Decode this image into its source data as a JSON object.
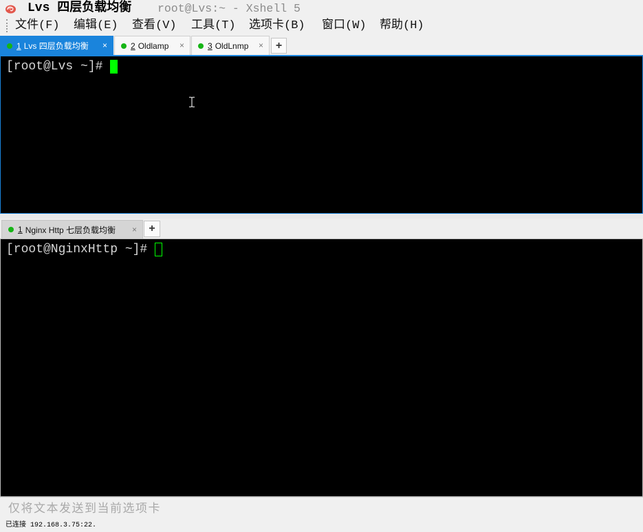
{
  "window": {
    "session_title": "Lvs 四层负载均衡",
    "subtitle": "root@Lvs:~ - Xshell 5",
    "app_icon": "xshell-app-icon"
  },
  "menu": {
    "items": [
      {
        "label": "文件(F)"
      },
      {
        "label": "编辑(E)"
      },
      {
        "label": "查看(V)"
      },
      {
        "label": "工具(T)"
      },
      {
        "label": "选项卡(B)"
      },
      {
        "label": "窗口(W)"
      },
      {
        "label": "帮助(H)"
      }
    ]
  },
  "top_pane": {
    "focused": true,
    "tabs": [
      {
        "number": "1",
        "label": "Lvs 四层负载均衡",
        "selected": true,
        "connected": true,
        "close": "×"
      },
      {
        "number": "2",
        "label": "Oldlamp",
        "selected": false,
        "connected": true,
        "close": "×"
      },
      {
        "number": "3",
        "label": "OldLnmp",
        "selected": false,
        "connected": true,
        "close": "×"
      }
    ],
    "new_tab": "+",
    "terminal": {
      "prompt": "[root@Lvs ~]#"
    }
  },
  "bottom_pane": {
    "focused": false,
    "tabs": [
      {
        "number": "1",
        "label": "Nginx Http 七层负载均衡",
        "selected": true,
        "connected": true,
        "close": "×"
      }
    ],
    "new_tab": "+",
    "terminal": {
      "prompt": "[root@NginxHttp ~]#"
    }
  },
  "compose_bar": {
    "placeholder": "仅将文本发送到当前选项卡"
  },
  "status_bar": {
    "text": "已连接 192.168.3.75:22."
  },
  "colors": {
    "accent": "#1a84dc",
    "terminal_bg": "#000000",
    "terminal_fg": "#d6d6d6",
    "cursor": "#00ff00",
    "connected_dot": "#16b516",
    "chrome": "#f0f0f0"
  }
}
